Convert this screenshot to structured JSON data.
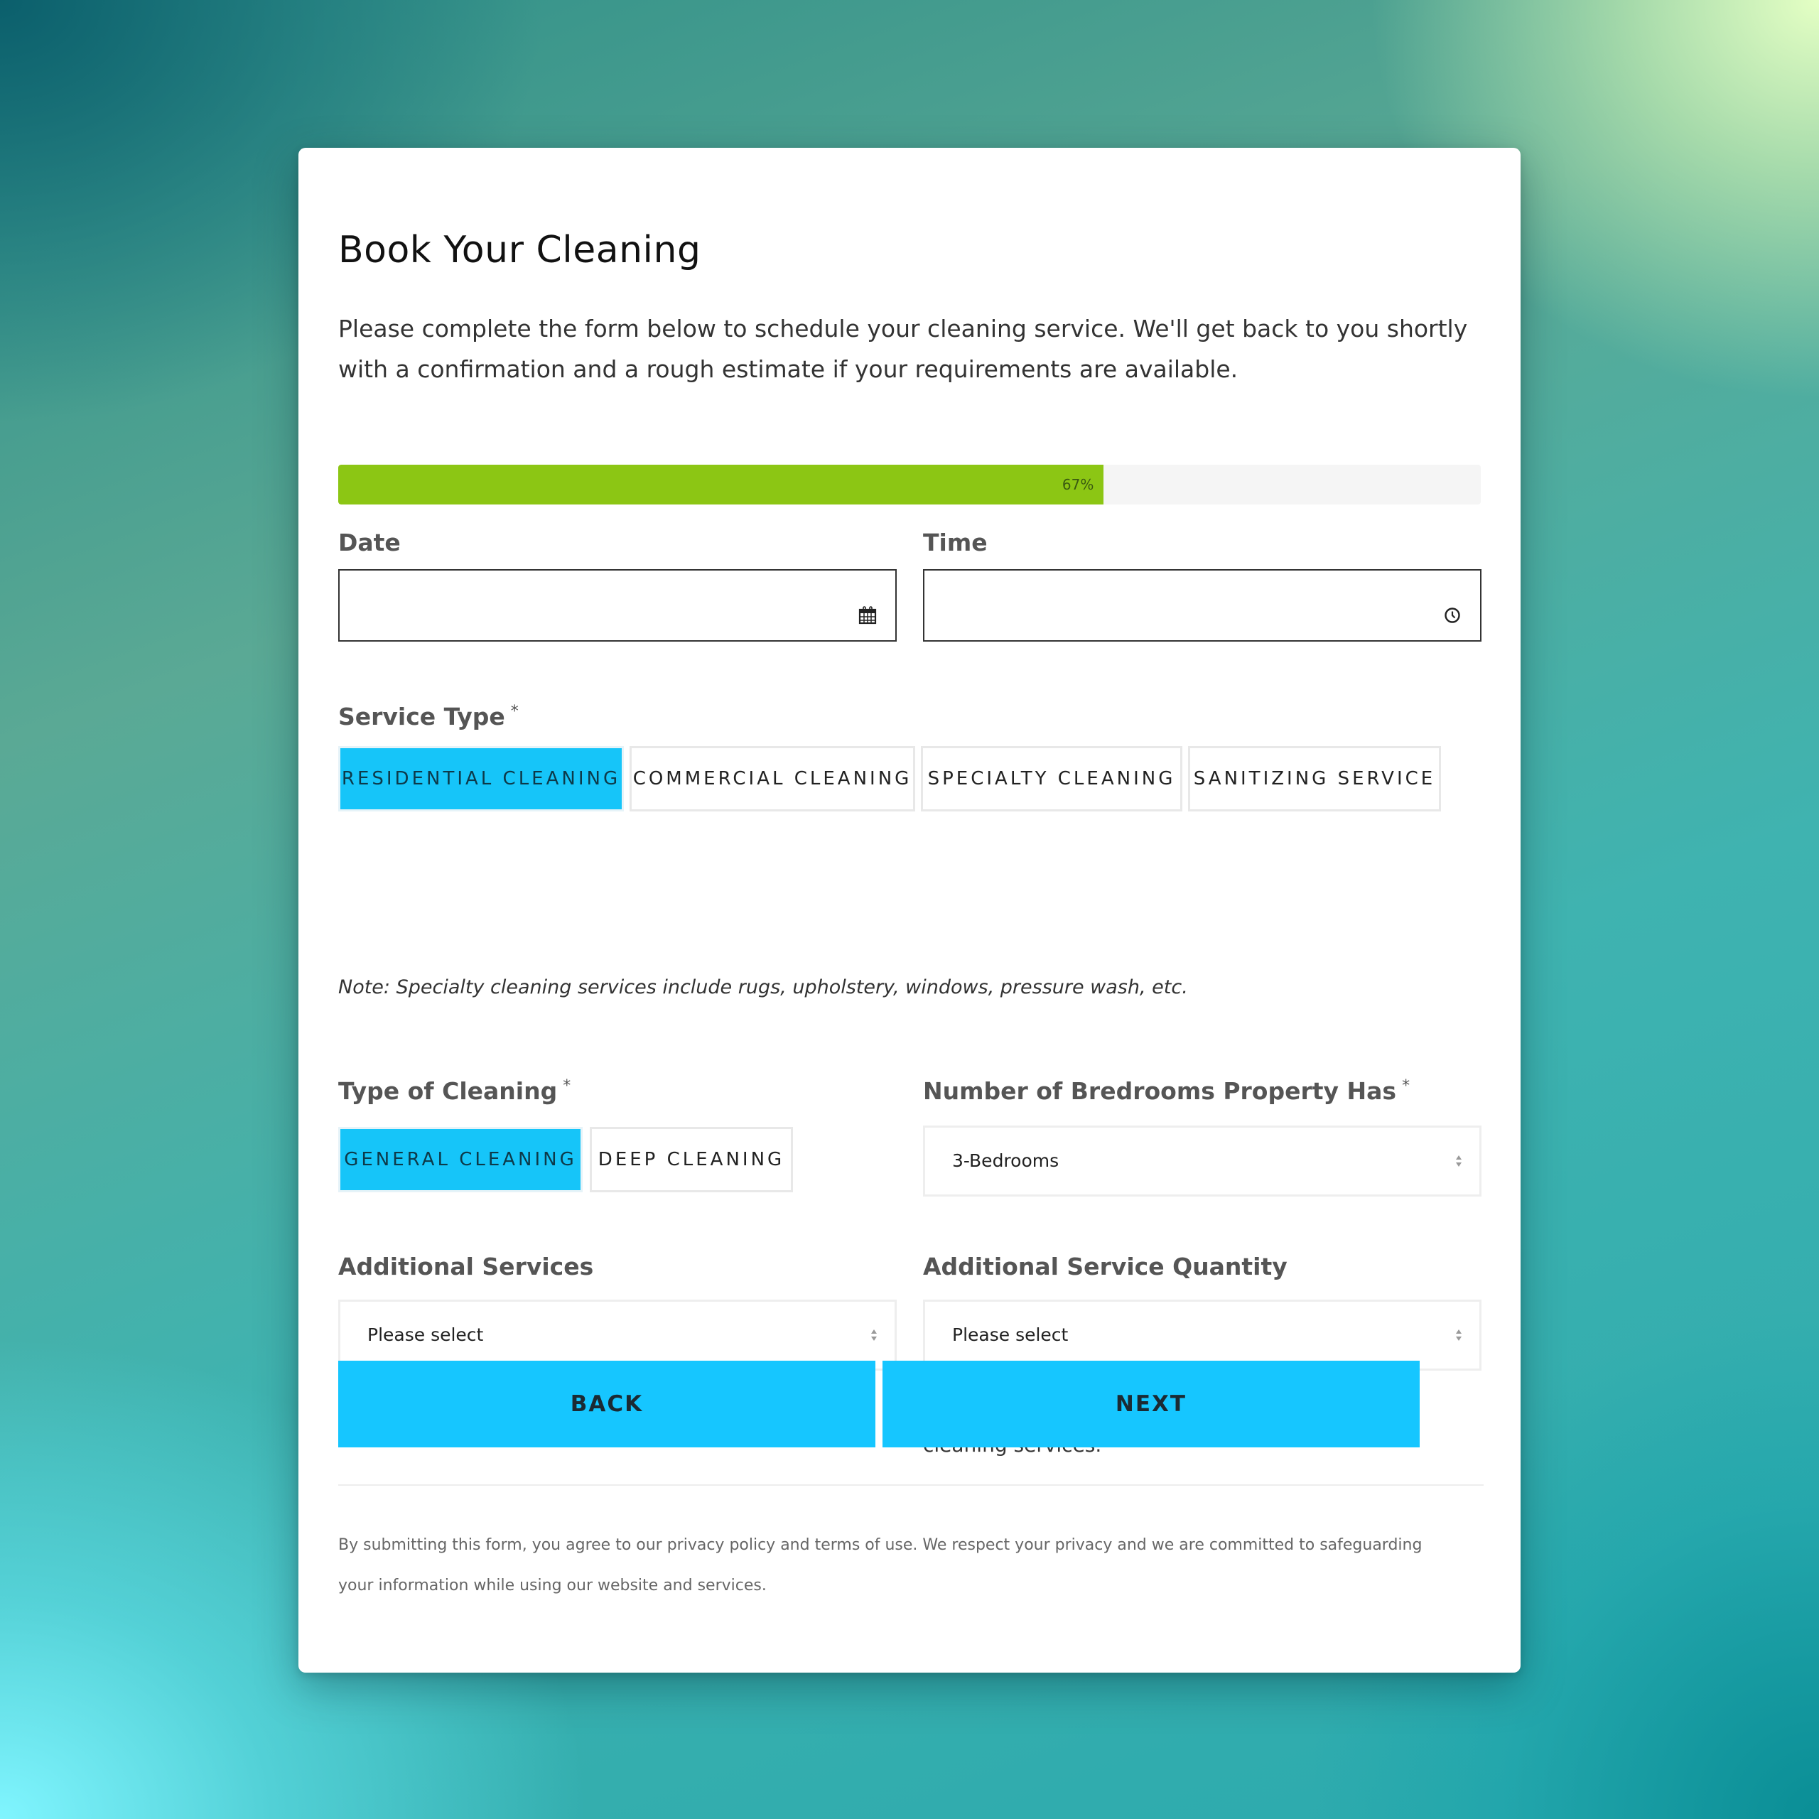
{
  "form": {
    "title": "Book Your Cleaning",
    "intro": "Please complete the form below to schedule your cleaning service. We'll get back to you shortly with a confirmation and a rough estimate if your requirements are available.",
    "progress": {
      "percent": 67,
      "label": "67%",
      "color": "#8cc614"
    },
    "date": {
      "label": "Date",
      "value": "",
      "icon": "calendar-icon"
    },
    "time": {
      "label": "Time",
      "value": "",
      "icon": "clock-icon"
    },
    "service_type": {
      "label": "Service Type",
      "required_mark": "*",
      "options": [
        {
          "label": "RESIDENTIAL CLEANING",
          "selected": true
        },
        {
          "label": "COMMERCIAL CLEANING",
          "selected": false
        },
        {
          "label": "SPECIALTY CLEANING",
          "selected": false
        },
        {
          "label": "SANITIZING SERVICE",
          "selected": false
        }
      ],
      "note": "Note: Specialty cleaning services include rugs, upholstery, windows, pressure wash, etc."
    },
    "type_of_cleaning": {
      "label": "Type of Cleaning",
      "required_mark": "*",
      "options": [
        {
          "label": "GENERAL CLEANING",
          "selected": true
        },
        {
          "label": "DEEP CLEANING",
          "selected": false
        }
      ]
    },
    "bedrooms": {
      "label": "Number of Bredrooms Property Has",
      "required_mark": "*",
      "value": "3-Bedrooms"
    },
    "additional_services": {
      "label": "Additional Services",
      "value": "Please select"
    },
    "additional_quantity": {
      "label": "Additional Service Quantity",
      "value": "Please select",
      "help": "Bed lining laundry is typically included in our cleaning services."
    },
    "buttons": {
      "back": "BACK",
      "next": "NEXT"
    },
    "accent_color": "#16c6ff",
    "footer": "By submitting this form, you agree to our privacy policy and terms of use. We respect your privacy and we are committed to safeguarding your information while using our website and services."
  }
}
